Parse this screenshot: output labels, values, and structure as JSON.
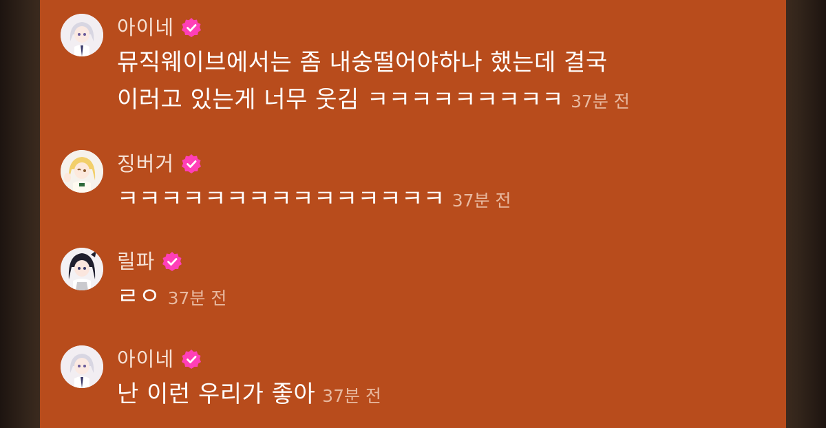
{
  "messages": [
    {
      "name": "아이네",
      "verified": true,
      "lines": [
        "뮤직웨이브에서는 좀 내숭떨어야하나 했는데 결국",
        "이러고 있는게 너무 웃김 ㅋㅋㅋㅋㅋㅋㅋㅋㅋ"
      ],
      "time": "37분 전"
    },
    {
      "name": "징버거",
      "verified": true,
      "lines": [
        "ㅋㅋㅋㅋㅋㅋㅋㅋㅋㅋㅋㅋㅋㅋㅋ"
      ],
      "time": "37분 전"
    },
    {
      "name": "릴파",
      "verified": true,
      "lines": [
        "ㄹㅇ"
      ],
      "time": "37분 전"
    },
    {
      "name": "아이네",
      "verified": true,
      "lines": [
        "난 이런 우리가 좋아"
      ],
      "time": "37분 전"
    }
  ],
  "icons": {
    "verified": "verified-badge-icon"
  },
  "colors": {
    "panel_bg": "#b84c1c",
    "name_text": "#f6e2d6",
    "message_text": "#ffffff",
    "time_text": "#e8b9a0",
    "badge": "#ff3fb8",
    "side_bg": "#2a1f18"
  }
}
